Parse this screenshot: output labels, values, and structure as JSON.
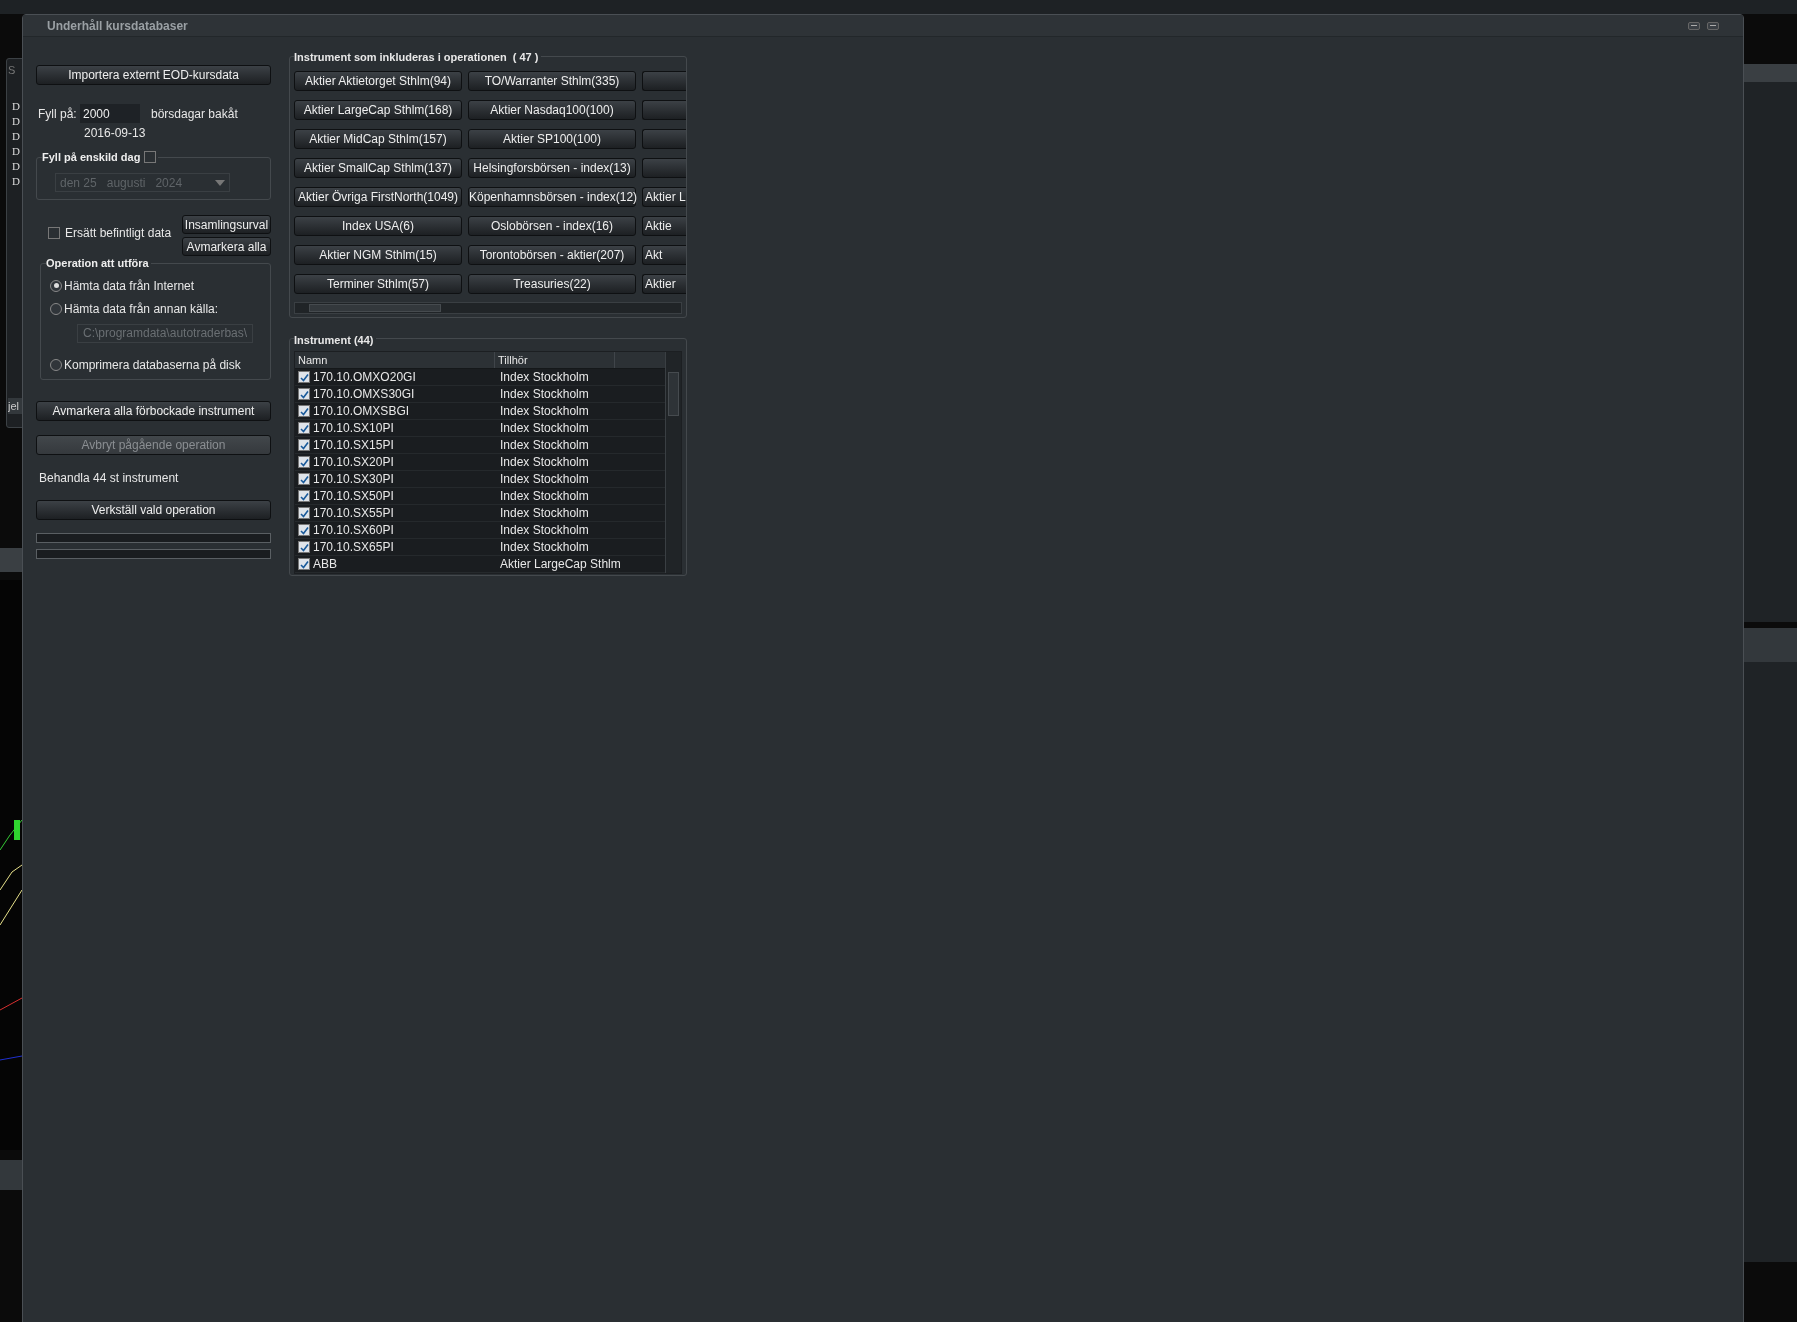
{
  "background": {
    "title": "S",
    "lines": [
      "D",
      "D",
      "D",
      "D",
      "D",
      "D"
    ],
    "footer": "jel"
  },
  "window": {
    "title": "Underhåll kursdatabaser"
  },
  "import_button": "Importera externt EOD-kursdata",
  "fill": {
    "label": "Fyll på:",
    "value": "2000",
    "unit": "börsdagar bakåt",
    "date": "2016-09-13"
  },
  "single_day": {
    "title": "Fyll på enskild dag",
    "checked": false,
    "day": "den 25",
    "month": "augusti",
    "year": "2024"
  },
  "replace_existing": {
    "label": "Ersätt befintligt data",
    "checked": false
  },
  "side_buttons": [
    "Insamlingsurval",
    "Avmarkera alla"
  ],
  "operation": {
    "title": "Operation att utföra",
    "options": [
      {
        "label": "Hämta data från Internet",
        "selected": true
      },
      {
        "label": "Hämta data från annan källa:",
        "selected": false,
        "path": "C:\\programdata\\autotraderbas\\"
      },
      {
        "label": "Komprimera databaserna på disk",
        "selected": false
      }
    ]
  },
  "actions": [
    {
      "label": "Avmarkera alla förbockade instrument",
      "disabled": false
    },
    {
      "label": "Avbryt pågående operation",
      "disabled": true
    }
  ],
  "status": "Behandla 44 st instrument",
  "run_button": "Verkställ vald operation",
  "progress": [
    {
      "level": 0
    },
    {
      "level": 0
    }
  ],
  "groups": {
    "title": "Instrument som inkluderas i operationen",
    "count": "( 47 )",
    "rows": [
      {
        "buttons": [
          "Aktier Aktietorget Sthlm(94)",
          "TO/Warranter Sthlm(335)"
        ]
      },
      {
        "buttons": [
          "Aktier LargeCap Sthlm(168)",
          "Aktier Nasdaq100(100)"
        ]
      },
      {
        "buttons": [
          "Aktier MidCap Sthlm(157)",
          "Aktier SP100(100)"
        ]
      },
      {
        "buttons": [
          "Aktier SmallCap Sthlm(137)",
          "Helsingforsbörsen - index(13)"
        ]
      },
      {
        "buttons": [
          "Aktier Övriga FirstNorth(1049)",
          "Köpenhamnsbörsen - index(12)"
        ],
        "cut": "Aktier L"
      },
      {
        "buttons": [
          "Index USA(6)",
          "Oslobörsen - index(16)"
        ],
        "cut": "Aktie"
      },
      {
        "buttons": [
          "Aktier NGM Sthlm(15)",
          "Torontobörsen - aktier(207)"
        ],
        "cut": "Akt"
      },
      {
        "buttons": [
          "Terminer Sthlm(57)",
          "Treasuries(22)"
        ],
        "cut": "Aktier"
      }
    ]
  },
  "instruments": {
    "title": "Instrument (44)",
    "columns": [
      "Namn",
      "Tillhör"
    ],
    "rows": [
      {
        "name": "170.10.OMXO20GI",
        "group": "Index Stockholm",
        "checked": true
      },
      {
        "name": "170.10.OMXS30GI",
        "group": "Index Stockholm",
        "checked": true
      },
      {
        "name": "170.10.OMXSBGI",
        "group": "Index Stockholm",
        "checked": true
      },
      {
        "name": "170.10.SX10PI",
        "group": "Index Stockholm",
        "checked": true
      },
      {
        "name": "170.10.SX15PI",
        "group": "Index Stockholm",
        "checked": true
      },
      {
        "name": "170.10.SX20PI",
        "group": "Index Stockholm",
        "checked": true
      },
      {
        "name": "170.10.SX30PI",
        "group": "Index Stockholm",
        "checked": true
      },
      {
        "name": "170.10.SX50PI",
        "group": "Index Stockholm",
        "checked": true
      },
      {
        "name": "170.10.SX55PI",
        "group": "Index Stockholm",
        "checked": true
      },
      {
        "name": "170.10.SX60PI",
        "group": "Index Stockholm",
        "checked": true
      },
      {
        "name": "170.10.SX65PI",
        "group": "Index Stockholm",
        "checked": true
      },
      {
        "name": "ABB",
        "group": "Aktier LargeCap Sthlm",
        "checked": true
      }
    ]
  }
}
